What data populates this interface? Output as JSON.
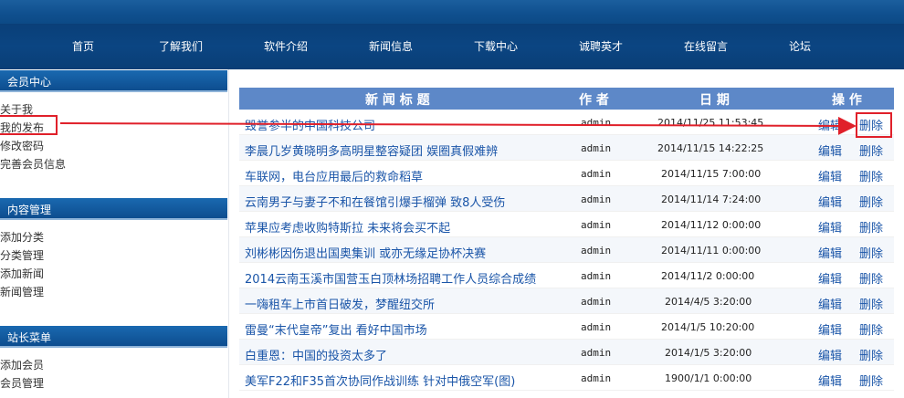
{
  "nav": {
    "items": [
      "首页",
      "了解我们",
      "软件介绍",
      "新闻信息",
      "下载中心",
      "诚聘英才",
      "在线留言",
      "论坛"
    ]
  },
  "sidebar": {
    "member": {
      "title": "会员中心",
      "links": [
        "关于我",
        "我的发布",
        "修改密码",
        "完善会员信息"
      ]
    },
    "content": {
      "title": "内容管理",
      "links": [
        "添加分类",
        "分类管理",
        "添加新闻",
        "新闻管理"
      ]
    },
    "admin": {
      "title": "站长菜单",
      "links": [
        "添加会员",
        "会员管理"
      ]
    }
  },
  "table": {
    "headers": {
      "title": "新 闻 标 题",
      "author": "作 者",
      "date": "日 期",
      "ops": "操 作"
    },
    "rows": [
      {
        "title": "毁誉参半的中国科技公司",
        "author": "admin",
        "date": "2014/11/25 11:53:45",
        "edit": "编辑",
        "del": "删除"
      },
      {
        "title": "李晨几岁黄晓明多高明星整容疑团 娱圈真假难辨",
        "author": "admin",
        "date": "2014/11/15 14:22:25",
        "edit": "编辑",
        "del": "删除"
      },
      {
        "title": "车联网，电台应用最后的救命稻草",
        "author": "admin",
        "date": "2014/11/15 7:00:00",
        "edit": "编辑",
        "del": "删除"
      },
      {
        "title": "云南男子与妻子不和在餐馆引爆手榴弹 致8人受伤",
        "author": "admin",
        "date": "2014/11/14 7:24:00",
        "edit": "编辑",
        "del": "删除"
      },
      {
        "title": "苹果应考虑收购特斯拉 未来将会买不起",
        "author": "admin",
        "date": "2014/11/12 0:00:00",
        "edit": "编辑",
        "del": "删除"
      },
      {
        "title": "刘彬彬因伤退出国奥集训 或亦无缘足协杯决赛",
        "author": "admin",
        "date": "2014/11/11 0:00:00",
        "edit": "编辑",
        "del": "删除"
      },
      {
        "title": "2014云南玉溪市国营玉白顶林场招聘工作人员综合成绩",
        "author": "admin",
        "date": "2014/11/2 0:00:00",
        "edit": "编辑",
        "del": "删除"
      },
      {
        "title": "一嗨租车上市首日破发，梦醒纽交所",
        "author": "admin",
        "date": "2014/4/5 3:20:00",
        "edit": "编辑",
        "del": "删除"
      },
      {
        "title": "雷曼“末代皇帝”复出 看好中国市场",
        "author": "admin",
        "date": "2014/1/5 10:20:00",
        "edit": "编辑",
        "del": "删除"
      },
      {
        "title": "白重恩：中国的投资太多了",
        "author": "admin",
        "date": "2014/1/5 3:20:00",
        "edit": "编辑",
        "del": "删除"
      },
      {
        "title": "美军F22和F35首次协同作战训练 针对中俄空军(图)",
        "author": "admin",
        "date": "1900/1/1 0:00:00",
        "edit": "编辑",
        "del": "删除"
      }
    ]
  },
  "annotation": {
    "color": "#e0202a"
  }
}
